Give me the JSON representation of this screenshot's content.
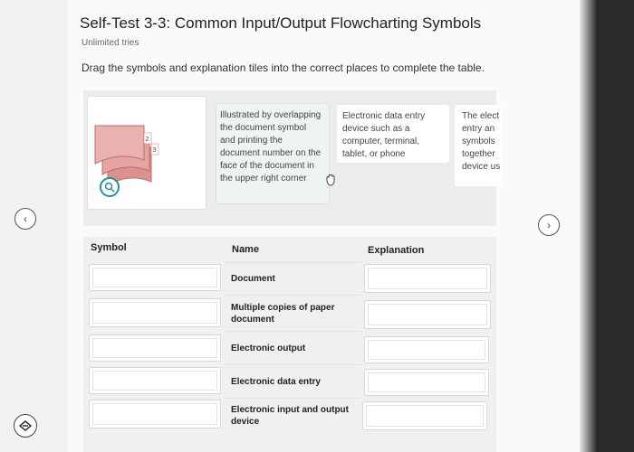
{
  "header": {
    "title": "Self-Test 3-3: Common Input/Output Flowcharting Symbols",
    "subtitle": "Unlimited tries",
    "instruction": "Drag the symbols and explanation tiles into the correct places to complete the table."
  },
  "bank": {
    "tile_1_text": "Illustrated by overlapping the document symbol and printing the document number on the face of the document in the upper right corner",
    "tile_2_text": "Electronic data entry device such as a computer, terminal, tablet, or phone",
    "tile_3_text": "The elect entry an symbols together device us",
    "doc_numbers": [
      "2",
      "3"
    ]
  },
  "table": {
    "headers": {
      "symbol": "Symbol",
      "name": "Name",
      "explanation": "Explanation"
    },
    "rows": [
      {
        "name": "Document"
      },
      {
        "name": "Multiple copies of paper document"
      },
      {
        "name": "Electronic output"
      },
      {
        "name": "Electronic data entry"
      },
      {
        "name": "Electronic input and output device"
      }
    ]
  },
  "nav": {
    "prev_glyph": "‹",
    "next_glyph": "›"
  },
  "colors": {
    "accent": "#2a8ca0",
    "doc_symbol": "#e4a4a0"
  },
  "icons": [
    "zoom-icon",
    "hand-cursor-icon",
    "chevron-left-icon",
    "chevron-right-icon",
    "bottom-tool-icon"
  ]
}
